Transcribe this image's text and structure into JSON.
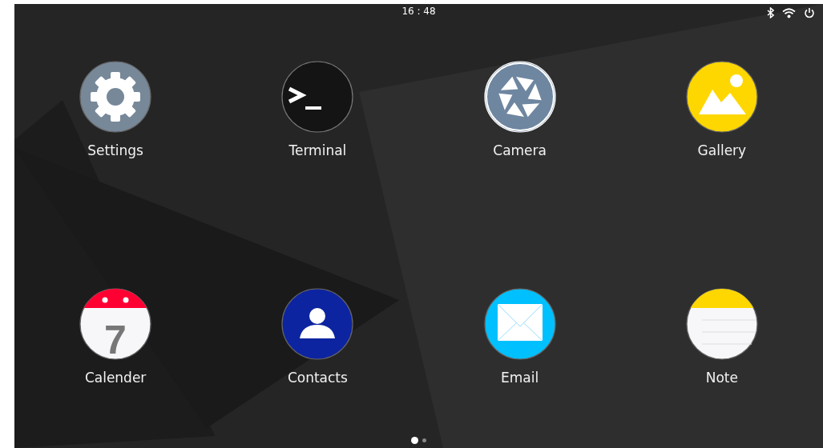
{
  "status_bar": {
    "time": "16 : 48"
  },
  "apps": [
    {
      "label": "Settings",
      "kind": "settings"
    },
    {
      "label": "Terminal",
      "kind": "terminal"
    },
    {
      "label": "Camera",
      "kind": "camera"
    },
    {
      "label": "Gallery",
      "kind": "gallery"
    },
    {
      "label": "Calender",
      "kind": "calendar",
      "day": "7"
    },
    {
      "label": "Contacts",
      "kind": "contacts"
    },
    {
      "label": "Email",
      "kind": "email"
    },
    {
      "label": "Note",
      "kind": "note"
    }
  ],
  "page_dots": [
    {
      "selected": true
    },
    {
      "selected": false
    }
  ]
}
